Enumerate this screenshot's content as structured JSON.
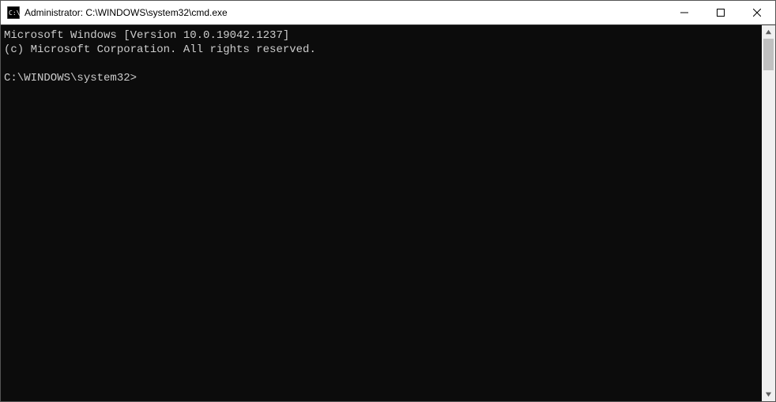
{
  "titlebar": {
    "title": "Administrator: C:\\WINDOWS\\system32\\cmd.exe"
  },
  "terminal": {
    "line1": "Microsoft Windows [Version 10.0.19042.1237]",
    "line2": "(c) Microsoft Corporation. All rights reserved.",
    "blank": "",
    "prompt": "C:\\WINDOWS\\system32>"
  }
}
